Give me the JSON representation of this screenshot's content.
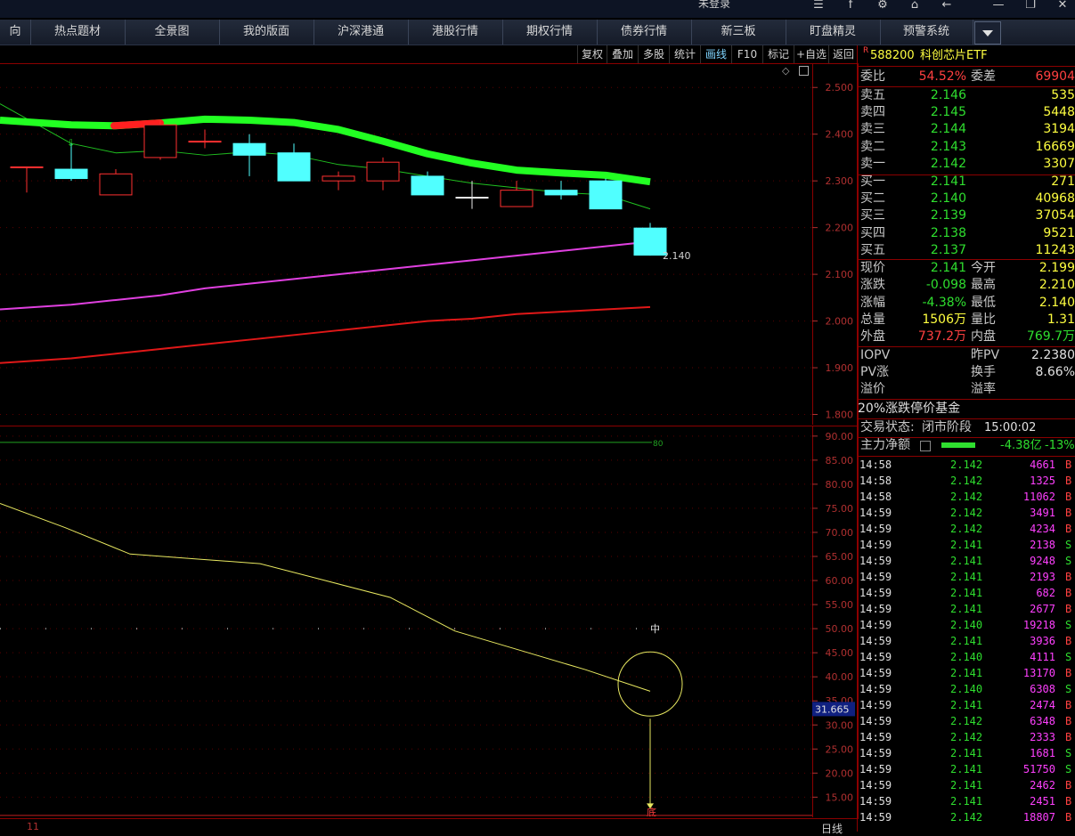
{
  "window": {
    "title": "未登录"
  },
  "nav": {
    "items": [
      "向",
      "热点题材",
      "全景图",
      "我的版面",
      "沪深港通",
      "港股行情",
      "期权行情",
      "债券行情",
      "新三板",
      "盯盘精灵",
      "预警系统"
    ]
  },
  "toolbar": {
    "items": [
      "复权",
      "叠加",
      "多股",
      "统计",
      "画线",
      "F10",
      "标记",
      "+自选",
      "返回"
    ],
    "active": "画线"
  },
  "chart_data": [
    {
      "type": "candlestick",
      "title": "",
      "ylabel": "",
      "yticks": [
        "2.500",
        "2.400",
        "2.300",
        "2.200",
        "2.100",
        "2.000",
        "1.900",
        "1.800"
      ],
      "ylim": [
        1.78,
        2.55
      ],
      "last_price_label": "2.140",
      "candles": [
        {
          "open": 2.33,
          "close": 2.33,
          "high": 2.33,
          "low": 2.275,
          "color": "red"
        },
        {
          "open": 2.325,
          "close": 2.305,
          "high": 2.38,
          "low": 2.3,
          "color": "cyan"
        },
        {
          "open": 2.27,
          "close": 2.315,
          "high": 2.325,
          "low": 2.27,
          "color": "red"
        },
        {
          "open": 2.35,
          "close": 2.42,
          "high": 2.43,
          "low": 2.345,
          "color": "red"
        },
        {
          "open": 2.385,
          "close": 2.385,
          "high": 2.41,
          "low": 2.37,
          "color": "red"
        },
        {
          "open": 2.38,
          "close": 2.355,
          "high": 2.4,
          "low": 2.31,
          "color": "cyan"
        },
        {
          "open": 2.36,
          "close": 2.3,
          "high": 2.38,
          "low": 2.3,
          "color": "cyan"
        },
        {
          "open": 2.3,
          "close": 2.31,
          "high": 2.32,
          "low": 2.28,
          "color": "red"
        },
        {
          "open": 2.3,
          "close": 2.34,
          "high": 2.35,
          "low": 2.28,
          "color": "red"
        },
        {
          "open": 2.31,
          "close": 2.27,
          "high": 2.32,
          "low": 2.27,
          "color": "cyan"
        },
        {
          "open": 2.265,
          "close": 2.265,
          "high": 2.3,
          "low": 2.24,
          "color": "white"
        },
        {
          "open": 2.245,
          "close": 2.28,
          "high": 2.3,
          "low": 2.245,
          "color": "red"
        },
        {
          "open": 2.28,
          "close": 2.27,
          "high": 2.3,
          "low": 2.26,
          "color": "cyan"
        },
        {
          "open": 2.3,
          "close": 2.24,
          "high": 2.305,
          "low": 2.24,
          "color": "cyan"
        },
        {
          "open": 2.199,
          "close": 2.141,
          "high": 2.21,
          "low": 2.14,
          "color": "cyan"
        }
      ],
      "ma_thick": [
        2.43,
        2.42,
        2.418,
        2.424,
        2.432,
        2.43,
        2.425,
        2.41,
        2.385,
        2.358,
        2.338,
        2.323,
        2.317,
        2.312,
        2.298
      ],
      "ma_thick_red_segment": [
        2,
        3
      ],
      "ma_green_thin": [
        2.465,
        2.38,
        2.36,
        2.365,
        2.355,
        2.362,
        2.355,
        2.335,
        2.325,
        2.31,
        2.295,
        2.285,
        2.275,
        2.27,
        2.24
      ],
      "ma_magenta": [
        2.025,
        2.035,
        2.045,
        2.055,
        2.07,
        2.08,
        2.09,
        2.1,
        2.11,
        2.12,
        2.13,
        2.14,
        2.15,
        2.16,
        2.17
      ],
      "ma_red": [
        1.91,
        1.92,
        1.93,
        1.94,
        1.95,
        1.96,
        1.97,
        1.98,
        1.99,
        2.0,
        2.005,
        2.015,
        2.02,
        2.025,
        2.03
      ]
    },
    {
      "type": "line",
      "title": "",
      "yticks": [
        "90.00",
        "85.00",
        "80.00",
        "75.00",
        "70.00",
        "65.00",
        "60.00",
        "55.00",
        "50.00",
        "45.00",
        "40.00",
        "35.00",
        "30.00",
        "25.00",
        "20.00",
        "15.00"
      ],
      "ylim": [
        11,
        92
      ],
      "current_value_label": "31.665",
      "series": [
        {
          "name": "",
          "values": [
            76.0,
            71.0,
            65.5,
            64.5,
            63.5,
            60.0,
            56.5,
            49.5,
            45.5,
            41.5,
            37.0
          ]
        }
      ],
      "markers": {
        "mid_label": "中",
        "bottom_label": "底",
        "top_label": "80"
      },
      "x_label": "11",
      "footer": "日线"
    }
  ],
  "panel": {
    "code": "588200",
    "name": "科创芯片ETF",
    "flag": "R",
    "weibi": {
      "label": "委比",
      "value": "54.52%"
    },
    "weicha": {
      "label": "委差",
      "value": "69904"
    },
    "asks": [
      {
        "label": "卖五",
        "price": "2.146",
        "vol": "535"
      },
      {
        "label": "卖四",
        "price": "2.145",
        "vol": "5448"
      },
      {
        "label": "卖三",
        "price": "2.144",
        "vol": "3194"
      },
      {
        "label": "卖二",
        "price": "2.143",
        "vol": "16669"
      },
      {
        "label": "卖一",
        "price": "2.142",
        "vol": "3307"
      }
    ],
    "bids": [
      {
        "label": "买一",
        "price": "2.141",
        "vol": "271"
      },
      {
        "label": "买二",
        "price": "2.140",
        "vol": "40968"
      },
      {
        "label": "买三",
        "price": "2.139",
        "vol": "37054"
      },
      {
        "label": "买四",
        "price": "2.138",
        "vol": "9521"
      },
      {
        "label": "买五",
        "price": "2.137",
        "vol": "11243"
      }
    ],
    "stats": [
      {
        "l1": "现价",
        "v1": "2.141",
        "c1": "#2fdf2f",
        "l2": "今开",
        "v2": "2.199",
        "c2": "#ffff40"
      },
      {
        "l1": "涨跌",
        "v1": "-0.098",
        "c1": "#2fdf2f",
        "l2": "最高",
        "v2": "2.210",
        "c2": "#ffff40"
      },
      {
        "l1": "涨幅",
        "v1": "-4.38%",
        "c1": "#2fdf2f",
        "l2": "最低",
        "v2": "2.140",
        "c2": "#ffff40"
      },
      {
        "l1": "总量",
        "v1": "1506万",
        "c1": "#ffff40",
        "l2": "量比",
        "v2": "1.31",
        "c2": "#ffff40"
      },
      {
        "l1": "外盘",
        "v1": "737.2万",
        "c1": "#ff4040",
        "l2": "内盘",
        "v2": "769.7万",
        "c2": "#2fdf2f"
      }
    ],
    "iopv": {
      "l1": "IOPV",
      "v1": "",
      "l2": "昨PV",
      "v2": "2.2380"
    },
    "pv": {
      "l1": "PV涨",
      "v1": "",
      "l2": "换手",
      "v2": "8.66%"
    },
    "premium": {
      "l1": "溢价",
      "v1": "",
      "l2": "溢率",
      "v2": ""
    },
    "fund_type": "20%涨跌停价基金",
    "trade_state": {
      "label": "交易状态:",
      "value": "闭市阶段",
      "time": "15:00:02"
    },
    "main_flow": {
      "label": "主力净额",
      "value": "-4.38亿",
      "pct": "-13%"
    },
    "ticks": [
      {
        "t": "14:58",
        "p": "2.142",
        "v": "4661",
        "s": "B"
      },
      {
        "t": "14:58",
        "p": "2.142",
        "v": "1325",
        "s": "B"
      },
      {
        "t": "14:58",
        "p": "2.142",
        "v": "11062",
        "s": "B"
      },
      {
        "t": "14:59",
        "p": "2.142",
        "v": "3491",
        "s": "B"
      },
      {
        "t": "14:59",
        "p": "2.142",
        "v": "4234",
        "s": "B"
      },
      {
        "t": "14:59",
        "p": "2.141",
        "v": "2138",
        "s": "S"
      },
      {
        "t": "14:59",
        "p": "2.141",
        "v": "9248",
        "s": "S"
      },
      {
        "t": "14:59",
        "p": "2.141",
        "v": "2193",
        "s": "B"
      },
      {
        "t": "14:59",
        "p": "2.141",
        "v": "682",
        "s": "B"
      },
      {
        "t": "14:59",
        "p": "2.141",
        "v": "2677",
        "s": "B"
      },
      {
        "t": "14:59",
        "p": "2.140",
        "v": "19218",
        "s": "S"
      },
      {
        "t": "14:59",
        "p": "2.141",
        "v": "3936",
        "s": "B"
      },
      {
        "t": "14:59",
        "p": "2.140",
        "v": "4111",
        "s": "S"
      },
      {
        "t": "14:59",
        "p": "2.141",
        "v": "13170",
        "s": "B"
      },
      {
        "t": "14:59",
        "p": "2.140",
        "v": "6308",
        "s": "S"
      },
      {
        "t": "14:59",
        "p": "2.141",
        "v": "2474",
        "s": "B"
      },
      {
        "t": "14:59",
        "p": "2.142",
        "v": "6348",
        "s": "B"
      },
      {
        "t": "14:59",
        "p": "2.142",
        "v": "2333",
        "s": "B"
      },
      {
        "t": "14:59",
        "p": "2.141",
        "v": "1681",
        "s": "S"
      },
      {
        "t": "14:59",
        "p": "2.141",
        "v": "51750",
        "s": "S"
      },
      {
        "t": "14:59",
        "p": "2.141",
        "v": "2462",
        "s": "B"
      },
      {
        "t": "14:59",
        "p": "2.141",
        "v": "2451",
        "s": "B"
      },
      {
        "t": "14:59",
        "p": "2.142",
        "v": "18807",
        "s": "B"
      }
    ],
    "colors": {
      "up": "#ff4040",
      "down": "#2fdf2f",
      "yellow": "#ffff40",
      "magenta": "#ff40ff"
    }
  }
}
